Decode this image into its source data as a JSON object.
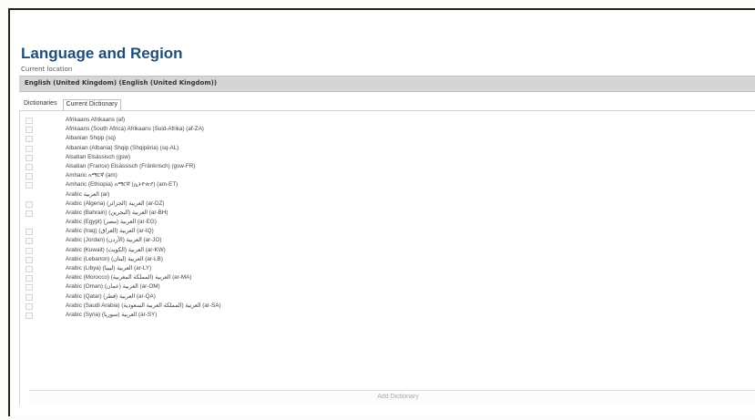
{
  "title": "Language and Region",
  "current_location": {
    "label": "Current location",
    "value": "English (United Kingdom) (English (United Kingdom))"
  },
  "tabs": [
    {
      "label": "Dictionaries",
      "active": false
    },
    {
      "label": "Current Dictionary",
      "active": true
    }
  ],
  "languages": [
    {
      "label": "Afrikaans Afrikaans (af)",
      "checkbox": true
    },
    {
      "label": "Afrikaans (South Africa) Afrikaans (Suid-Afrika) (af-ZA)",
      "checkbox": true
    },
    {
      "label": "Albanian Shqip (sq)",
      "checkbox": true
    },
    {
      "label": "Albanian (Albania) Shqip (Shqipëria) (sq-AL)",
      "checkbox": true
    },
    {
      "label": "Alsatian Elsässisch (gsw)",
      "checkbox": true
    },
    {
      "label": "Alsatian (France) Elsässisch (Fränkrisch) (gsw-FR)",
      "checkbox": true
    },
    {
      "label": "Amharic አማርኛ (am)",
      "checkbox": true
    },
    {
      "label": "Amharic (Ethiopia) አማርኛ (ኢትዮጵያ) (am-ET)",
      "checkbox": true
    },
    {
      "label": "Arabic العربية (ar)",
      "checkbox": false
    },
    {
      "label": "Arabic (Algeria) العربية (الجزائر) (ar-DZ)",
      "checkbox": true
    },
    {
      "label": "Arabic (Bahrain) العربية (البحرين) (ar-BH)",
      "checkbox": true
    },
    {
      "label": "Arabic (Egypt) العربية (مصر) (ar-EG)",
      "checkbox": false
    },
    {
      "label": "Arabic (Iraq) العربية (العراق) (ar-IQ)",
      "checkbox": true
    },
    {
      "label": "Arabic (Jordan) العربية (الأردن) (ar-JO)",
      "checkbox": true
    },
    {
      "label": "Arabic (Kuwait) العربية (الكويت) (ar-KW)",
      "checkbox": true
    },
    {
      "label": "Arabic (Lebanon) العربية (لبنان) (ar-LB)",
      "checkbox": true
    },
    {
      "label": "Arabic (Libya) العربية (ليبيا) (ar-LY)",
      "checkbox": true
    },
    {
      "label": "Arabic (Morocco) العربية (المملكة المغربية) (ar-MA)",
      "checkbox": true
    },
    {
      "label": "Arabic (Oman) العربية (عمان) (ar-OM)",
      "checkbox": true
    },
    {
      "label": "Arabic (Qatar) العربية (قطر) (ar-QA)",
      "checkbox": true
    },
    {
      "label": "Arabic (Saudi Arabia) العربية (المملكة العربية السعودية) (ar-SA)",
      "checkbox": true
    },
    {
      "label": "Arabic (Syria) العربية (سوريا) (ar-SY)",
      "checkbox": true
    }
  ],
  "add_dictionary_label": "Add Dictionary"
}
